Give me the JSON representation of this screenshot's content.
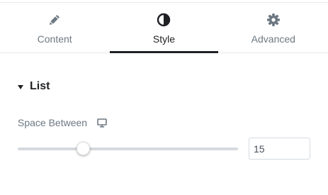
{
  "tabs": [
    {
      "label": "Content",
      "icon": "pencil-icon",
      "active": false
    },
    {
      "label": "Style",
      "icon": "half-circle-contrast-icon",
      "active": true
    },
    {
      "label": "Advanced",
      "icon": "gear-icon",
      "active": false
    }
  ],
  "section": {
    "title": "List",
    "expanded": true
  },
  "control": {
    "label": "Space Between",
    "device_icon": "desktop-monitor-icon",
    "value": "15",
    "slider_level": 0.3
  },
  "colors": {
    "text_dark": "#1f2124",
    "text_muted": "#6d7882",
    "track": "#d5dadf",
    "border": "#e6e8ea"
  }
}
